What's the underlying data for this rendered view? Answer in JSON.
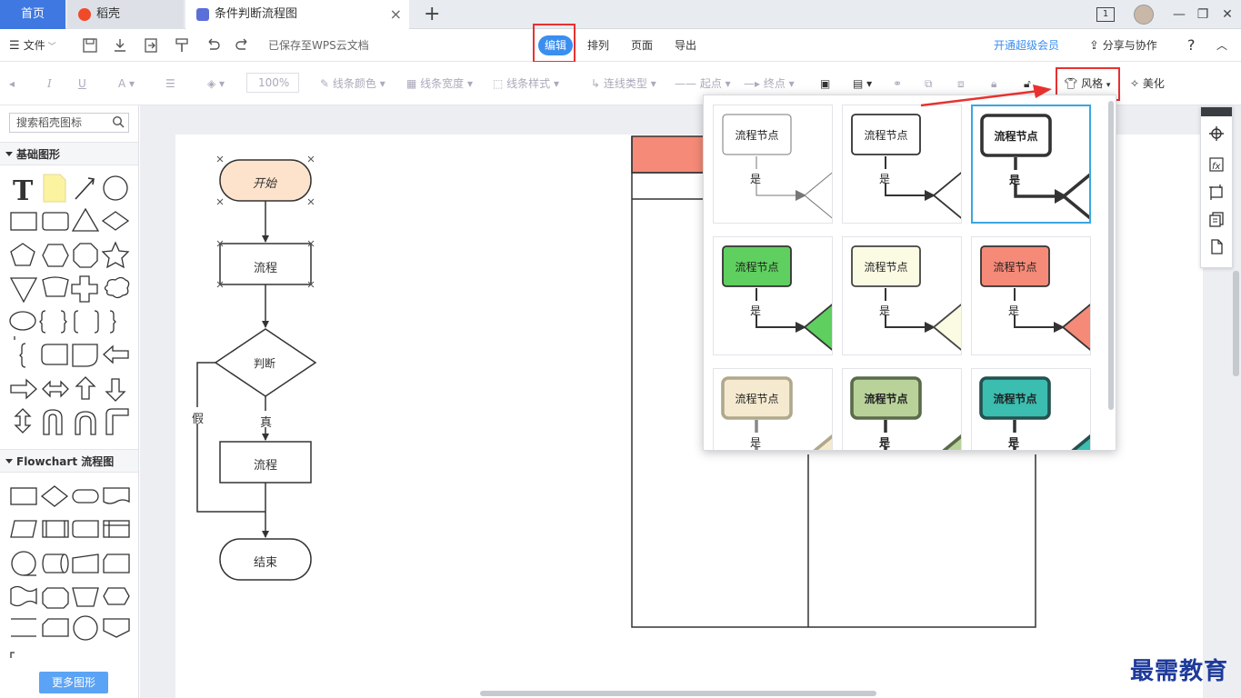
{
  "tabs": {
    "home": "首页",
    "daoke": "稻壳",
    "doc": "条件判断流程图",
    "close": "×",
    "add": "+"
  },
  "window": {
    "badge": "1",
    "min": "—",
    "restore": "❐",
    "close": "✕"
  },
  "menubar": {
    "file": "文件",
    "saved": "已保存至WPS云文档",
    "menus": [
      "编辑",
      "排列",
      "页面",
      "导出"
    ],
    "vip": "开通超级会员",
    "share": "分享与协作",
    "help": "?"
  },
  "toolbar": {
    "zoom": "100%",
    "line_color": "线条颜色",
    "line_width": "线条宽度",
    "line_style": "线条样式",
    "connector": "连线类型",
    "start": "起点",
    "end": "终点",
    "style": "风格",
    "beautify": "美化"
  },
  "sidebar": {
    "search_placeholder": "搜索稻壳图标",
    "basic": "基础图形",
    "flowchart": "Flowchart 流程图",
    "more": "更多图形"
  },
  "flow": {
    "start": "开始",
    "process1": "流程",
    "decision": "判断",
    "true_label": "真",
    "false_label": "假",
    "process2": "流程",
    "end": "结束"
  },
  "styles": {
    "node_label": "流程节点",
    "yes_label": "是",
    "cards": [
      {
        "fill": "#ffffff",
        "stroke": "#777777",
        "line": "#777777",
        "weight": 1,
        "bold": false
      },
      {
        "fill": "#ffffff",
        "stroke": "#333333",
        "line": "#333333",
        "weight": 2,
        "bold": false
      },
      {
        "fill": "#ffffff",
        "stroke": "#333333",
        "line": "#333333",
        "weight": 4,
        "bold": true
      },
      {
        "fill": "#5fcf5f",
        "stroke": "#333333",
        "line": "#333333",
        "weight": 2,
        "bold": false
      },
      {
        "fill": "#fbfbe3",
        "stroke": "#444444",
        "line": "#333333",
        "weight": 2,
        "bold": false
      },
      {
        "fill": "#f48a77",
        "stroke": "#333333",
        "line": "#333333",
        "weight": 2,
        "bold": false
      },
      {
        "fill": "#f5ead0",
        "stroke": "#b0a88c",
        "line": "#888888",
        "weight": 4,
        "bold": false
      },
      {
        "fill": "#b9d29a",
        "stroke": "#5a6b4a",
        "line": "#333333",
        "weight": 4,
        "bold": true
      },
      {
        "fill": "#3bbdb0",
        "stroke": "#24514f",
        "line": "#333333",
        "weight": 4,
        "bold": true
      }
    ]
  },
  "watermark": "最需教育",
  "colors": {
    "accent": "#3a8ef0",
    "highlight": "#e8312f",
    "selected": "#3aa6e0",
    "start_fill": "#fde3cc",
    "swimlane_header": "#f48a77"
  }
}
